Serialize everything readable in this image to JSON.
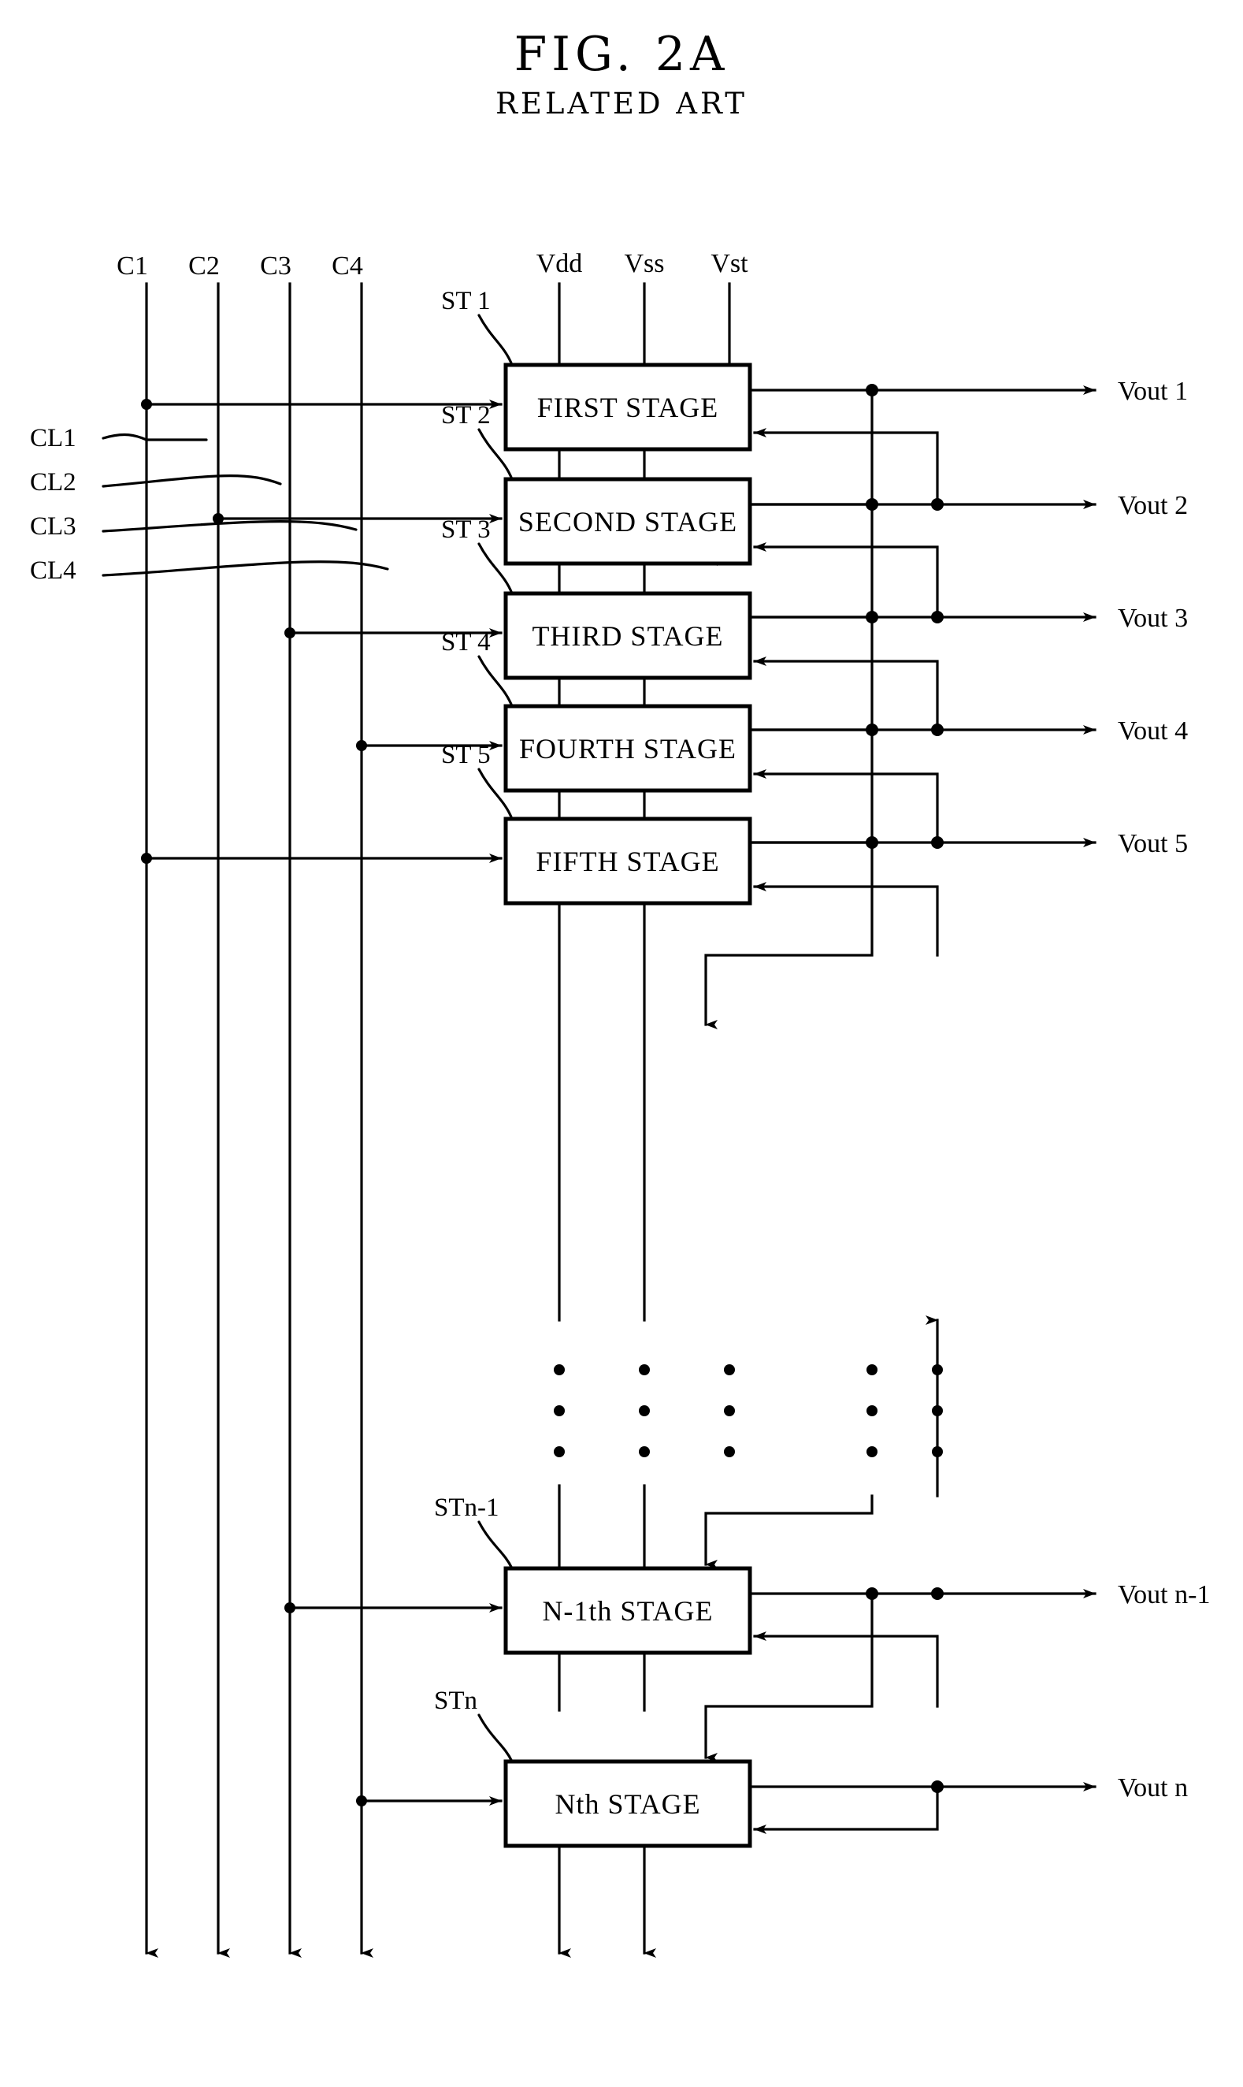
{
  "figure": {
    "title": "FIG. 2A",
    "subtitle": "RELATED ART",
    "type": "block-diagram",
    "domain": "patent-drawing"
  },
  "clock_rails": {
    "top_labels": [
      "C1",
      "C2",
      "C3",
      "C4"
    ],
    "side_labels": [
      "CL1",
      "CL2",
      "CL3",
      "CL4"
    ]
  },
  "power_rails": {
    "labels": [
      "Vdd",
      "Vss",
      "Vst"
    ]
  },
  "stages": [
    {
      "tag": "ST 1",
      "name": "FIRST STAGE",
      "output": "Vout 1"
    },
    {
      "tag": "ST 2",
      "name": "SECOND STAGE",
      "output": "Vout 2"
    },
    {
      "tag": "ST 3",
      "name": "THIRD STAGE",
      "output": "Vout 3"
    },
    {
      "tag": "ST 4",
      "name": "FOURTH STAGE",
      "output": "Vout 4"
    },
    {
      "tag": "ST 5",
      "name": "FIFTH STAGE",
      "output": "Vout 5"
    },
    {
      "tag": "STn-1",
      "name": "N-1th STAGE",
      "output": "Vout n-1"
    },
    {
      "tag": "STn",
      "name": "Nth STAGE",
      "output": "Vout n"
    }
  ],
  "ellipsis": {
    "glyph": "•",
    "columns": 5,
    "rows": 3
  },
  "colors": {
    "ink": "#000000",
    "paper": "#ffffff"
  }
}
